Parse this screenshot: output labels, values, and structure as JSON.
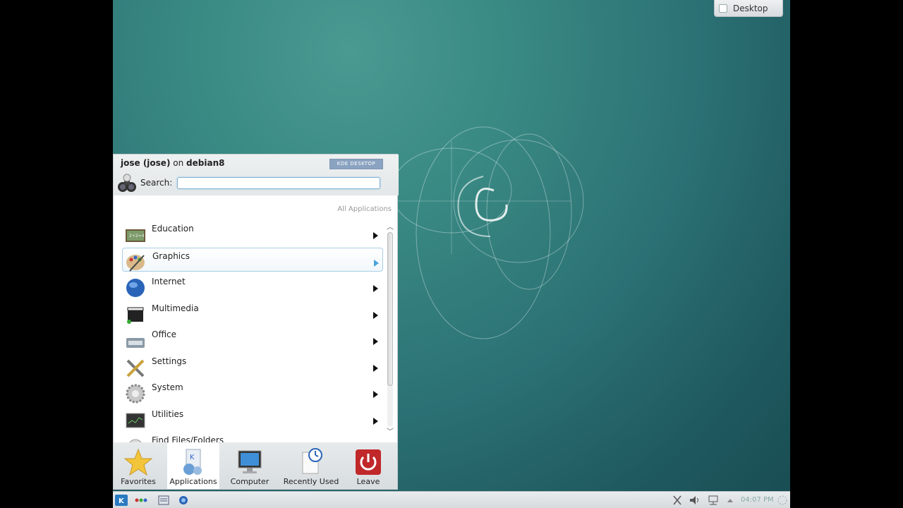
{
  "desktop": {
    "pager_label": "Desktop"
  },
  "menu": {
    "user": "jose (jose)",
    "on_word": "on",
    "host": "debian8",
    "kde_badge": "KDE DESKTOP",
    "search_label": "Search:",
    "search_value": "",
    "all_applications": "All Applications",
    "categories": [
      {
        "label": "Education",
        "icon": "education-icon"
      },
      {
        "label": "Graphics",
        "icon": "graphics-icon",
        "selected": true
      },
      {
        "label": "Internet",
        "icon": "internet-icon"
      },
      {
        "label": "Multimedia",
        "icon": "multimedia-icon"
      },
      {
        "label": "Office",
        "icon": "office-icon"
      },
      {
        "label": "Settings",
        "icon": "settings-icon"
      },
      {
        "label": "System",
        "icon": "system-icon"
      },
      {
        "label": "Utilities",
        "icon": "utilities-icon"
      },
      {
        "label": "Find Files/Folders",
        "icon": "find-icon"
      }
    ],
    "tabs": [
      {
        "label": "Favorites",
        "icon": "star-icon"
      },
      {
        "label": "Applications",
        "icon": "applications-icon",
        "active": true
      },
      {
        "label": "Computer",
        "icon": "computer-icon"
      },
      {
        "label": "Recently Used",
        "icon": "recent-icon"
      },
      {
        "label": "Leave",
        "icon": "power-icon"
      }
    ]
  },
  "taskbar": {
    "clock": "04:07 PM"
  },
  "colors": {
    "selection_border": "#a9cde6",
    "desktop_teal": "#2c7275",
    "leave_red": "#c0282a"
  }
}
